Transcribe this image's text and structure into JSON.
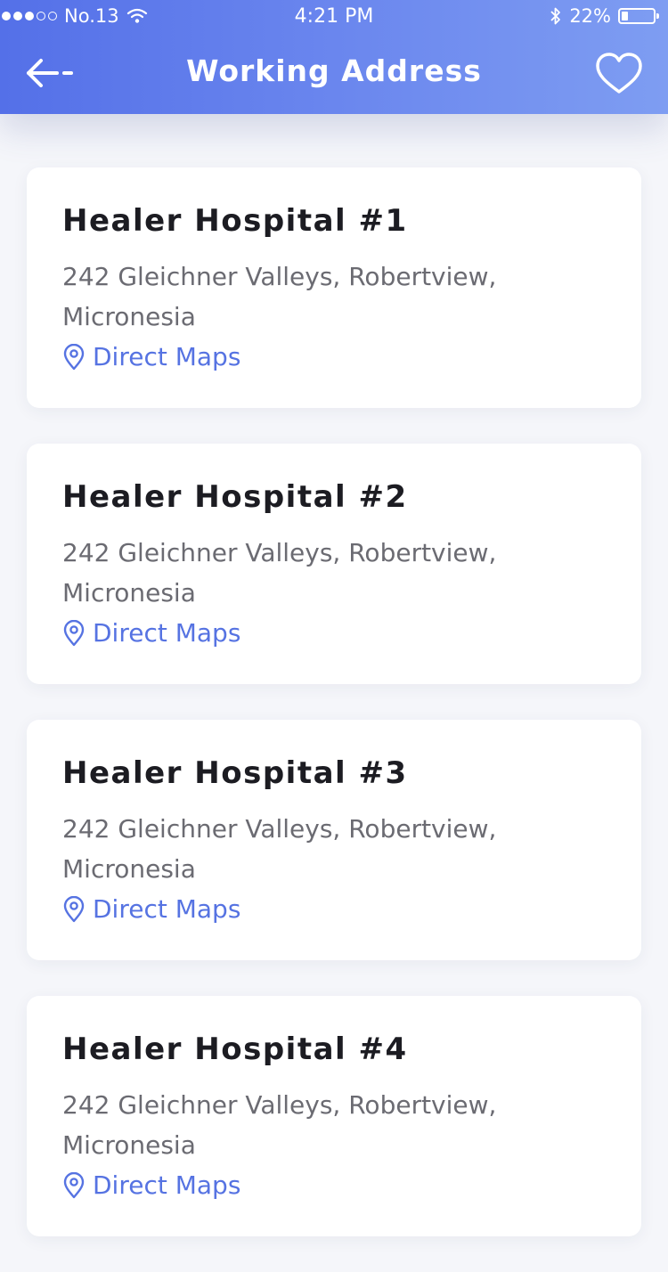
{
  "status_bar": {
    "carrier": "No.13",
    "time": "4:21 PM",
    "battery_text": "22%",
    "battery_level": 0.22
  },
  "header": {
    "title": "Working Address",
    "back_icon": "arrow-left-icon",
    "favorite_icon": "heart-outline-icon"
  },
  "colors": {
    "accent": "#5673e2",
    "header_gradient_start": "#5470e8",
    "header_gradient_end": "#7e9df2"
  },
  "addresses": [
    {
      "name": "Healer Hospital #1",
      "address": "242 Gleichner Valleys, Robertview, Micronesia",
      "link_label": "Direct Maps"
    },
    {
      "name": "Healer Hospital #2",
      "address": "242 Gleichner Valleys, Robertview, Micronesia",
      "link_label": "Direct Maps"
    },
    {
      "name": "Healer Hospital #3",
      "address": "242 Gleichner Valleys, Robertview, Micronesia",
      "link_label": "Direct Maps"
    },
    {
      "name": "Healer Hospital #4",
      "address": "242 Gleichner Valleys, Robertview, Micronesia",
      "link_label": "Direct Maps"
    }
  ]
}
